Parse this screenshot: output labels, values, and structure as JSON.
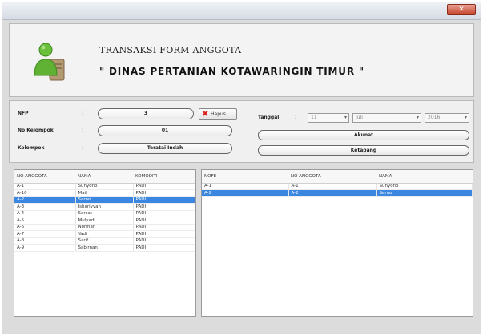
{
  "window": {
    "close_label": "✕"
  },
  "header": {
    "form_title": "TRANSAKSI FORM ANGGOTA",
    "org_title": "\" DINAS PERTANIAN KOTAWARINGIN TIMUR \""
  },
  "form": {
    "nfp_label": "NFP",
    "nfp_value": "3",
    "delete_label": "Hapus",
    "no_kelompok_label": "No Kelompok",
    "no_kelompok_value": "01",
    "kelompok_label": "Kelompok",
    "kelompok_value": "Teratai Indah",
    "colon": ":",
    "tanggal_label": "Tanggal",
    "tanggal_day": "11",
    "tanggal_month": "Juli",
    "tanggal_year": "2016",
    "simpan_label": "Akunat",
    "kembali_label": "Ketapang"
  },
  "left_table": {
    "columns": [
      "NO ANGGOTA",
      "NAMA",
      "KOMODITI"
    ],
    "rows": [
      [
        "A-1",
        "Sunyono",
        "PADI"
      ],
      [
        "A-10",
        "Mail",
        "PADI"
      ],
      [
        "A-2",
        "Sarno",
        "PADI"
      ],
      [
        "A-3",
        "Ishariyyah",
        "PADI"
      ],
      [
        "A-4",
        "Sarsat",
        "PADI"
      ],
      [
        "A-5",
        "Mulyadi",
        "PADI"
      ],
      [
        "A-6",
        "Norman",
        "PADI"
      ],
      [
        "A-7",
        "Yadi",
        "PADI"
      ],
      [
        "A-8",
        "Sarif",
        "PADI"
      ],
      [
        "A-9",
        "Sabirnan",
        "PADI"
      ]
    ],
    "selected_row": 2
  },
  "right_table": {
    "columns": [
      "NOFE",
      "NO ANGGOTA",
      "NAMA"
    ],
    "rows": [
      [
        "A-1",
        "A-1",
        "Sunyono"
      ],
      [
        "A-2",
        "A-2",
        "Sarno"
      ]
    ],
    "selected_row": 1
  }
}
